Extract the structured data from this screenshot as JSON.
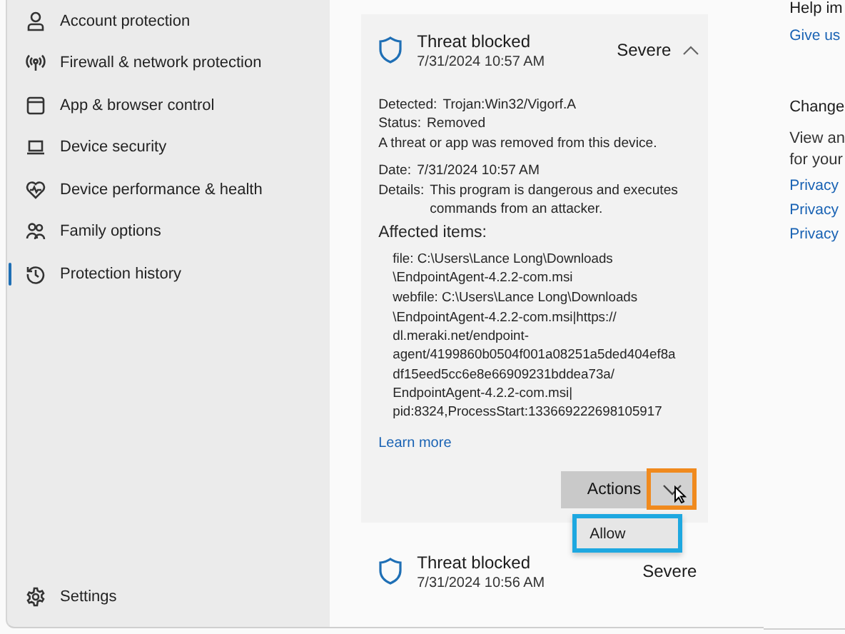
{
  "sidebar": {
    "items": [
      {
        "label": "Account protection",
        "selected": false
      },
      {
        "label": "Firewall & network protection",
        "selected": false
      },
      {
        "label": "App & browser control",
        "selected": false
      },
      {
        "label": "Device security",
        "selected": false
      },
      {
        "label": "Device performance & health",
        "selected": false
      },
      {
        "label": "Family options",
        "selected": false
      },
      {
        "label": "Protection history",
        "selected": true
      }
    ],
    "settings": {
      "label": "Settings"
    }
  },
  "history": [
    {
      "title": "Threat blocked",
      "date": "7/31/2024 10:57 AM",
      "severity": "Severe",
      "expanded": true,
      "details": {
        "rows": [
          {
            "label": "Detected:",
            "value": "Trojan:Win32/Vigorf.A"
          },
          {
            "label": "Status:",
            "value": "Removed"
          }
        ],
        "message": "A threat or app was removed from this device.",
        "rows2": [
          {
            "label": "Date:",
            "value": "7/31/2024 10:57 AM"
          },
          {
            "label": "Details:",
            "value": "This program is dangerous and executes commands from an attacker."
          }
        ],
        "affected_heading": "Affected items:",
        "affected_items": [
          {
            "lines": [
              "file: C:\\Users\\Lance Long\\Downloads",
              "\\EndpointAgent-4.2.2-com.msi"
            ]
          },
          {
            "lines": [
              "webfile: C:\\Users\\Lance Long\\Downloads",
              "\\EndpointAgent-4.2.2-com.msi|https://",
              "dl.meraki.net/endpoint-",
              "agent/4199860b0504f001a08251a5ded404ef8a",
              "df15eed5cc6e8e66909231bddea73a/",
              "EndpointAgent-4.2.2-com.msi|",
              "pid:8324,ProcessStart:133669222698105917"
            ]
          }
        ],
        "link": "Learn more"
      },
      "actions": {
        "label": "Actions",
        "menu_open": true,
        "menu": [
          "Allow"
        ]
      }
    },
    {
      "title": "Threat blocked",
      "date": "7/31/2024 10:56 AM",
      "severity": "Severe"
    }
  ],
  "side_panel": {
    "help_heading": "Help im",
    "help_link": "Give us",
    "change_heading": "Change",
    "change_text": [
      "View an",
      "for your"
    ],
    "links": [
      "Privacy",
      "Privacy",
      "Privacy"
    ]
  }
}
